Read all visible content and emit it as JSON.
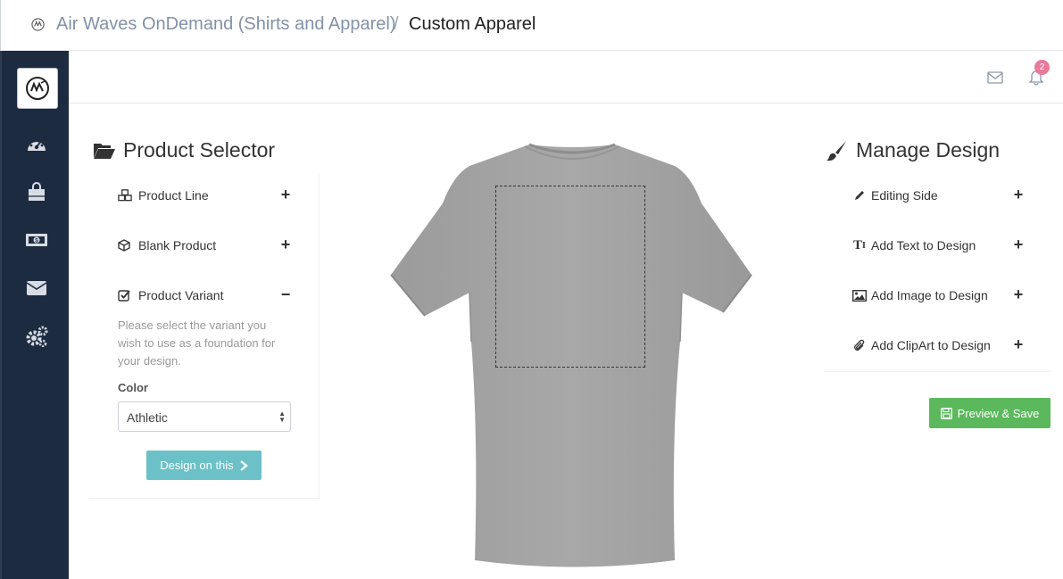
{
  "breadcrumb": {
    "parent": "Air Waves OnDemand (Shirts and Apparel)",
    "separator": "/",
    "current": "Custom Apparel"
  },
  "sidebar": {
    "brand_icon": "airwaves-logo",
    "items": [
      {
        "icon": "dashboard-icon"
      },
      {
        "icon": "shopping-bag-icon"
      },
      {
        "icon": "money-icon"
      },
      {
        "icon": "envelope-icon"
      },
      {
        "icon": "cogs-icon"
      }
    ]
  },
  "header": {
    "mail_icon": "envelope-outline-icon",
    "bell_icon": "bell-icon",
    "notification_count": "2"
  },
  "product_selector": {
    "title": "Product Selector",
    "rows": [
      {
        "label": "Product Line",
        "icon": "cubes-icon",
        "toggle": "+"
      },
      {
        "label": "Blank Product",
        "icon": "cube-icon",
        "toggle": "+"
      },
      {
        "label": "Product Variant",
        "icon": "check-square-icon",
        "toggle": "−"
      }
    ],
    "help_text": "Please select the variant you wish to use as a foundation for your design.",
    "color_label": "Color",
    "color_value": "Athletic",
    "design_button": "Design on this"
  },
  "manage_design": {
    "title": "Manage Design",
    "rows": [
      {
        "label": "Editing Side",
        "icon": "pencil-icon",
        "toggle": "+"
      },
      {
        "label": "Add Text to Design",
        "icon": "text-icon",
        "toggle": "+"
      },
      {
        "label": "Add Image to Design",
        "icon": "image-icon",
        "toggle": "+"
      },
      {
        "label": "Add ClipArt to Design",
        "icon": "paperclip-icon",
        "toggle": "+"
      }
    ],
    "preview_button": "Preview & Save"
  },
  "colors": {
    "sidebar": "#1d2b41",
    "design_button": "#6bc1c7",
    "preview_button": "#5cb85c",
    "badge": "#e9799a",
    "shirt": "#a3a3a3"
  }
}
